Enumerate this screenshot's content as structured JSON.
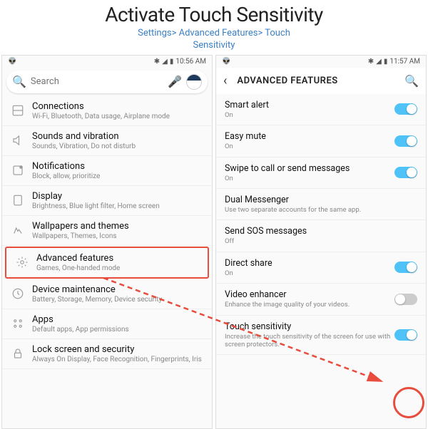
{
  "header": {
    "title": "Activate Touch Sensitivity",
    "breadcrumb": "Settings> Advanced Features> Touch\nSensitivity"
  },
  "left": {
    "status": {
      "time": "10:56 AM"
    },
    "search": {
      "placeholder": "Search"
    },
    "items": [
      {
        "title": "Connections",
        "sub": "Wi-Fi, Bluetooth, Data usage, Airplane mode"
      },
      {
        "title": "Sounds and vibration",
        "sub": "Sounds, Vibration, Do not disturb"
      },
      {
        "title": "Notifications",
        "sub": "Block, allow, prioritize"
      },
      {
        "title": "Display",
        "sub": "Brightness, Blue light filter, Home screen"
      },
      {
        "title": "Wallpapers and themes",
        "sub": "Wallpapers, Themes, Icons"
      },
      {
        "title": "Advanced features",
        "sub": "Games, One-handed mode"
      },
      {
        "title": "Device maintenance",
        "sub": "Battery, Storage, Memory, Device security"
      },
      {
        "title": "Apps",
        "sub": "Default apps, App permissions"
      },
      {
        "title": "Lock screen and security",
        "sub": "Always On Display, Face Recognition, Fingerprints, Iris"
      }
    ]
  },
  "right": {
    "status": {
      "time": "11:57 AM"
    },
    "header": {
      "title": "ADVANCED FEATURES"
    },
    "items": [
      {
        "title": "Smart alert",
        "sub": "On",
        "toggle": "on"
      },
      {
        "title": "Easy mute",
        "sub": "On",
        "toggle": "on"
      },
      {
        "title": "Swipe to call or send messages",
        "sub": "On",
        "toggle": "on"
      },
      {
        "title": "Dual Messenger",
        "sub": "Use two separate accounts for the same app.",
        "toggle": null
      },
      {
        "title": "Send SOS messages",
        "sub": "Off",
        "toggle": null
      },
      {
        "title": "Direct share",
        "sub": "On",
        "toggle": "on"
      },
      {
        "title": "Video enhancer",
        "sub": "Enhance the image quality of your videos.",
        "toggle": "off"
      },
      {
        "title": "Touch sensitivity",
        "sub": "Increase the touch sensitivity of the screen for use with screen protectors.",
        "toggle": "on"
      }
    ]
  }
}
